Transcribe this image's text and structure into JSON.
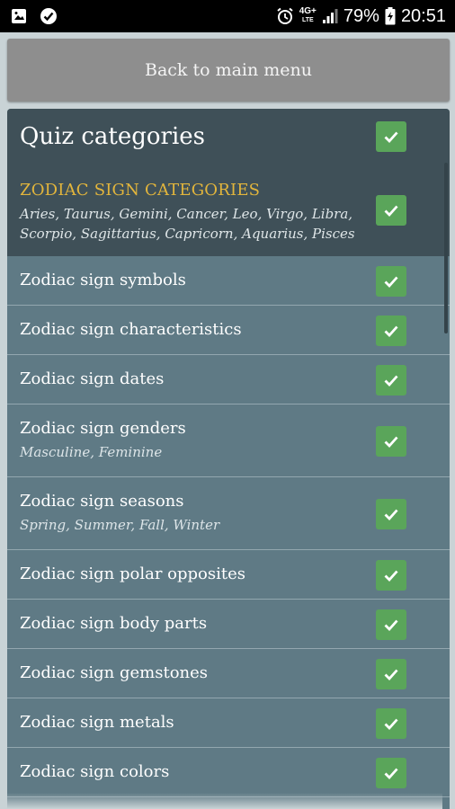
{
  "status_bar": {
    "battery": "79%",
    "time": "20:51",
    "network": "4G+",
    "network_sub": "LTE"
  },
  "back_button": {
    "label": "Back to main menu"
  },
  "panel": {
    "title": "Quiz categories",
    "category_heading": "ZODIAC SIGN CATEGORIES",
    "category_subtitle": "Aries, Taurus, Gemini, Cancer, Leo, Virgo, Libra, Scorpio, Sagittarius, Capricorn, Aquarius, Pisces",
    "items": [
      {
        "label": "Zodiac sign symbols",
        "sub": "",
        "checked": true
      },
      {
        "label": "Zodiac sign characteristics",
        "sub": "",
        "checked": true
      },
      {
        "label": "Zodiac sign dates",
        "sub": "",
        "checked": true
      },
      {
        "label": "Zodiac sign genders",
        "sub": "Masculine, Feminine",
        "checked": true
      },
      {
        "label": "Zodiac sign seasons",
        "sub": "Spring, Summer, Fall, Winter",
        "checked": true
      },
      {
        "label": "Zodiac sign polar opposites",
        "sub": "",
        "checked": true
      },
      {
        "label": "Zodiac sign body parts",
        "sub": "",
        "checked": true
      },
      {
        "label": "Zodiac sign gemstones",
        "sub": "",
        "checked": true
      },
      {
        "label": "Zodiac sign metals",
        "sub": "",
        "checked": true
      },
      {
        "label": "Zodiac sign colors",
        "sub": "",
        "checked": true
      }
    ]
  },
  "colors": {
    "checkbox": "#5aa55a",
    "heading_accent": "#e2b53c",
    "panel": "#5f7a85",
    "panel_header": "#3f5058"
  }
}
